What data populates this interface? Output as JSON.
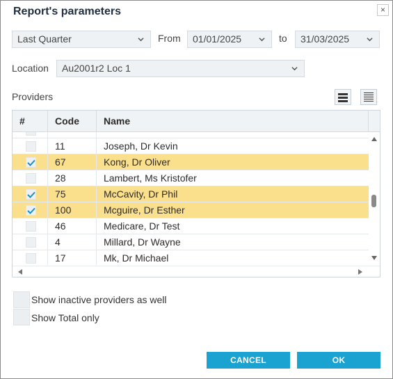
{
  "dialog": {
    "title": "Report's parameters",
    "close_glyph": "×"
  },
  "period": {
    "preset": "Last Quarter",
    "from_label": "From",
    "from_value": "01/01/2025",
    "to_label": "to",
    "to_value": "31/03/2025"
  },
  "location": {
    "label": "Location",
    "value": "Au2001r2 Loc 1"
  },
  "providers": {
    "label": "Providers",
    "view_icons": [
      "list-view-icon",
      "compact-list-view-icon"
    ],
    "columns": {
      "check": "#",
      "code": "Code",
      "name": "Name"
    },
    "rows": [
      {
        "code": "",
        "name": "",
        "checked": false,
        "selected": false
      },
      {
        "code": "11",
        "name": "Joseph, Dr Kevin",
        "checked": false,
        "selected": false
      },
      {
        "code": "67",
        "name": "Kong, Dr Oliver",
        "checked": true,
        "selected": true
      },
      {
        "code": "28",
        "name": "Lambert, Ms Kristofer",
        "checked": false,
        "selected": false
      },
      {
        "code": "75",
        "name": "McCavity, Dr Phil",
        "checked": true,
        "selected": true
      },
      {
        "code": "100",
        "name": "Mcguire, Dr Esther",
        "checked": true,
        "selected": true
      },
      {
        "code": "46",
        "name": "Medicare, Dr Test",
        "checked": false,
        "selected": false
      },
      {
        "code": "4",
        "name": "Millard, Dr Wayne",
        "checked": false,
        "selected": false
      },
      {
        "code": "17",
        "name": "Mk, Dr Michael",
        "checked": false,
        "selected": false
      },
      {
        "code": "",
        "name": "",
        "checked": false,
        "selected": false
      }
    ]
  },
  "options": {
    "show_inactive": {
      "label": "Show inactive providers as well",
      "checked": false
    },
    "show_total": {
      "label": "Show Total only",
      "checked": false
    }
  },
  "buttons": {
    "cancel": "CANCEL",
    "ok": "OK"
  },
  "colors": {
    "accent": "#1aa3d0",
    "selected_row": "#fadf8c",
    "check": "#1a8fc4"
  }
}
